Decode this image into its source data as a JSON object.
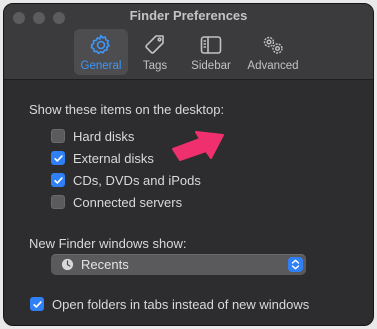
{
  "window": {
    "title": "Finder Preferences"
  },
  "toolbar": {
    "tabs": [
      {
        "label": "General",
        "icon": "gear-icon",
        "active": true
      },
      {
        "label": "Tags",
        "icon": "tag-icon",
        "active": false
      },
      {
        "label": "Sidebar",
        "icon": "sidebar-icon",
        "active": false
      },
      {
        "label": "Advanced",
        "icon": "gears-icon",
        "active": false
      }
    ]
  },
  "desktop_items": {
    "heading": "Show these items on the desktop:",
    "items": [
      {
        "label": "Hard disks",
        "checked": false
      },
      {
        "label": "External disks",
        "checked": true
      },
      {
        "label": "CDs, DVDs and iPods",
        "checked": true
      },
      {
        "label": "Connected servers",
        "checked": false
      }
    ]
  },
  "new_window": {
    "heading": "New Finder windows show:",
    "selected": "Recents",
    "icon": "clock-icon"
  },
  "open_in_tabs": {
    "label": "Open folders in tabs instead of new windows",
    "checked": true
  },
  "colors": {
    "accent": "#2f7ff5",
    "annotation_arrow": "#f0306e",
    "window_bg": "#2d2c2f",
    "toolbar_bg": "#3b3a3c"
  }
}
